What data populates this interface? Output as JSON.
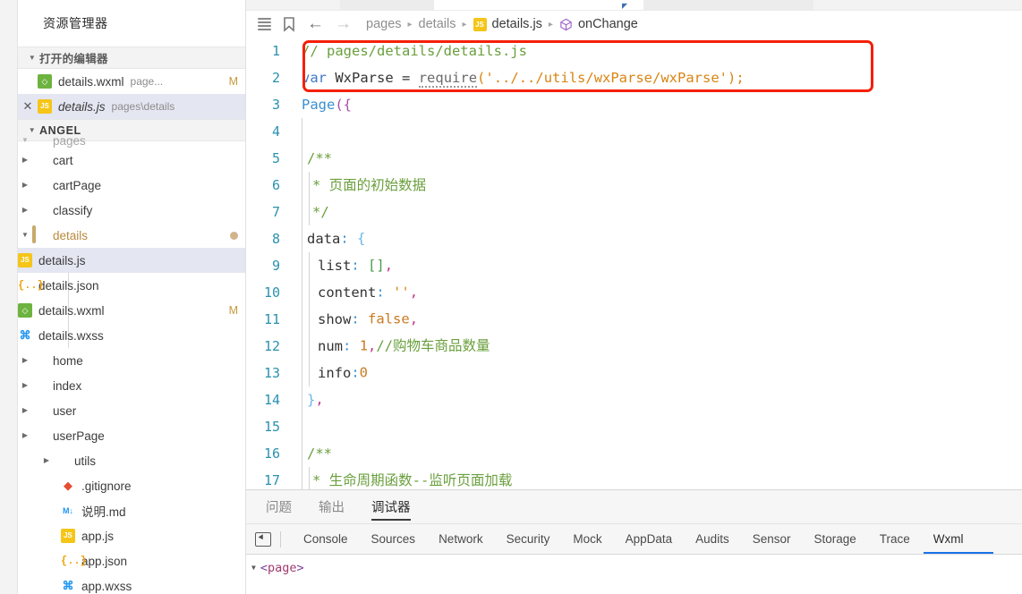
{
  "sidebar": {
    "title": "资源管理器",
    "open_editors": {
      "label": "打开的编辑器",
      "items": [
        {
          "name": "details.wxml",
          "path": "page...",
          "badge": "M",
          "icon": "wxml-file-icon",
          "closable": false,
          "selected": false
        },
        {
          "name": "details.js",
          "path": "pages\\details",
          "badge": "",
          "icon": "js-file-icon",
          "closable": true,
          "selected": true
        }
      ]
    },
    "project": {
      "label": "ANGEL",
      "tree": [
        {
          "label": "pages",
          "type": "folder",
          "depth": 0,
          "expanded": true,
          "icon": "folder-pink-icon",
          "clipped": true
        },
        {
          "label": "cart",
          "type": "folder",
          "depth": 1,
          "expanded": false,
          "icon": "folder-icon"
        },
        {
          "label": "cartPage",
          "type": "folder",
          "depth": 1,
          "expanded": false,
          "icon": "folder-icon"
        },
        {
          "label": "classify",
          "type": "folder",
          "depth": 1,
          "expanded": false,
          "icon": "folder-icon"
        },
        {
          "label": "details",
          "type": "folder",
          "depth": 1,
          "expanded": true,
          "icon": "folder-open-icon",
          "modified_dot": true
        },
        {
          "label": "details.js",
          "type": "file",
          "depth": 2,
          "icon": "js-file-icon",
          "selected": true
        },
        {
          "label": "details.json",
          "type": "file",
          "depth": 2,
          "icon": "json-file-icon"
        },
        {
          "label": "details.wxml",
          "type": "file",
          "depth": 2,
          "icon": "wxml-file-icon",
          "badge": "M"
        },
        {
          "label": "details.wxss",
          "type": "file",
          "depth": 2,
          "icon": "wxss-file-icon"
        },
        {
          "label": "home",
          "type": "folder",
          "depth": 1,
          "expanded": false,
          "icon": "folder-icon"
        },
        {
          "label": "index",
          "type": "folder",
          "depth": 1,
          "expanded": false,
          "icon": "folder-icon"
        },
        {
          "label": "user",
          "type": "folder",
          "depth": 1,
          "expanded": false,
          "icon": "folder-icon"
        },
        {
          "label": "userPage",
          "type": "folder",
          "depth": 1,
          "expanded": false,
          "icon": "folder-icon"
        },
        {
          "label": "utils",
          "type": "folder",
          "depth": 0,
          "expanded": false,
          "icon": "folder-green-icon"
        },
        {
          "label": ".gitignore",
          "type": "file",
          "depth": 0,
          "icon": "git-file-icon"
        },
        {
          "label": "说明.md",
          "type": "file",
          "depth": 0,
          "icon": "markdown-file-icon"
        },
        {
          "label": "app.js",
          "type": "file",
          "depth": 0,
          "icon": "js-file-icon"
        },
        {
          "label": "app.json",
          "type": "file",
          "depth": 0,
          "icon": "json-file-icon"
        },
        {
          "label": "app.wxss",
          "type": "file",
          "depth": 0,
          "icon": "wxss-file-icon"
        }
      ]
    }
  },
  "breadcrumb": {
    "segments": [
      {
        "label": "pages",
        "icon": ""
      },
      {
        "label": "details",
        "icon": ""
      },
      {
        "label": "details.js",
        "icon": "js-file-icon"
      },
      {
        "label": "onChange",
        "icon": "symbol-cube-icon"
      }
    ],
    "separator": "▸"
  },
  "editor": {
    "first_line_number": 1,
    "highlight_box_color": "#f51f08",
    "lines": [
      {
        "n": 1,
        "indent": 0
      },
      {
        "n": 2,
        "indent": 0
      },
      {
        "n": 3,
        "indent": 0
      },
      {
        "n": 4,
        "indent": 1
      },
      {
        "n": 5,
        "indent": 1
      },
      {
        "n": 6,
        "indent": 2
      },
      {
        "n": 7,
        "indent": 2
      },
      {
        "n": 8,
        "indent": 1
      },
      {
        "n": 9,
        "indent": 2
      },
      {
        "n": 10,
        "indent": 2
      },
      {
        "n": 11,
        "indent": 2
      },
      {
        "n": 12,
        "indent": 2
      },
      {
        "n": 13,
        "indent": 2
      },
      {
        "n": 14,
        "indent": 1
      },
      {
        "n": 15,
        "indent": 1
      },
      {
        "n": 16,
        "indent": 1
      },
      {
        "n": 17,
        "indent": 2
      }
    ],
    "code": {
      "l1_comment": "// pages/details/details.js",
      "l2_var": "var",
      "l2_name": "WxParse",
      "l2_eq": "=",
      "l2_require": "require",
      "l2_open": "(",
      "l2_string": "'../../utils/wxParse/wxParse'",
      "l2_close": ");",
      "l3_page": "Page",
      "l3_paren": "(",
      "l3_brace": "{",
      "l5": "/**",
      "l6": "* 页面的初始数据",
      "l7": "*/",
      "l8_key": "data",
      "l8_colon": ":",
      "l8_brace": "{",
      "l9_key": "list",
      "l9_colon": ":",
      "l9_val": "[]",
      "l9_comma": ",",
      "l10_key": "content",
      "l10_colon": ":",
      "l10_val": "''",
      "l10_comma": ",",
      "l11_key": "show",
      "l11_colon": ":",
      "l11_val": "false",
      "l11_comma": ",",
      "l12_key": "num",
      "l12_colon": ":",
      "l12_val": "1",
      "l12_comma": ",",
      "l12_comment": "//购物车商品数量",
      "l13_key": "info",
      "l13_colon": ":",
      "l13_val": "0",
      "l14_brace": "}",
      "l14_comma": ",",
      "l16": "/**",
      "l17": "* 生命周期函数--监听页面加载"
    }
  },
  "panel": {
    "tabs": [
      {
        "label": "问题",
        "active": false
      },
      {
        "label": "输出",
        "active": false
      },
      {
        "label": "调试器",
        "active": true
      }
    ],
    "devtools_tabs": [
      {
        "label": "Console",
        "active": false
      },
      {
        "label": "Sources",
        "active": false
      },
      {
        "label": "Network",
        "active": false
      },
      {
        "label": "Security",
        "active": false
      },
      {
        "label": "Mock",
        "active": false
      },
      {
        "label": "AppData",
        "active": false
      },
      {
        "label": "Audits",
        "active": false
      },
      {
        "label": "Sensor",
        "active": false
      },
      {
        "label": "Storage",
        "active": false
      },
      {
        "label": "Trace",
        "active": false
      },
      {
        "label": "Wxml",
        "active": true
      }
    ],
    "active_tab_underline_color": "#1a73e8",
    "dom": {
      "triangle": "▼",
      "open_angle": "<",
      "tag": "page",
      "close_angle": ">"
    }
  }
}
